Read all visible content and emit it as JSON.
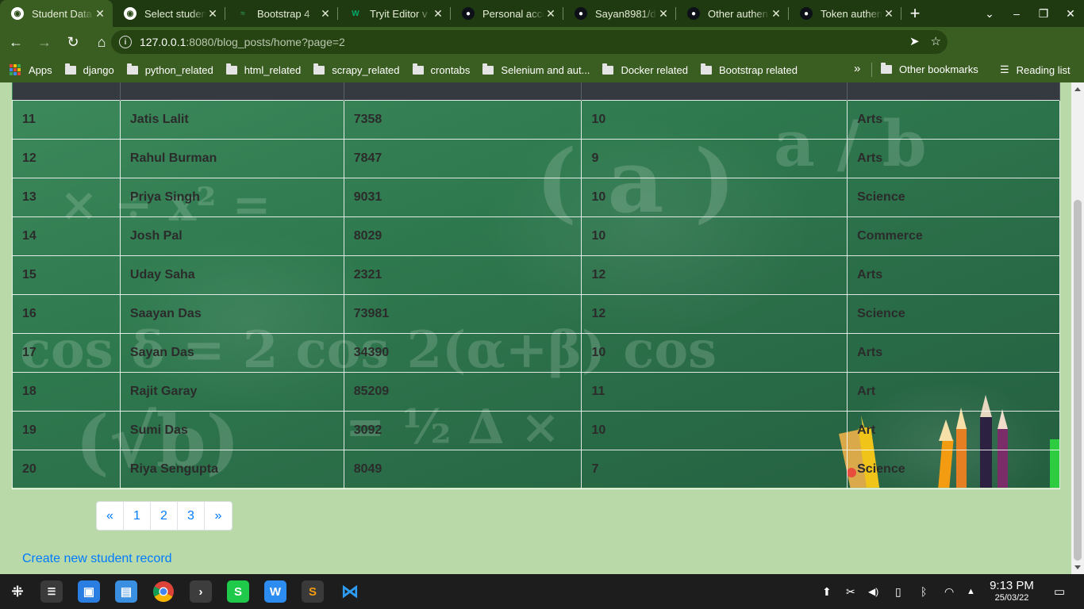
{
  "tabs": [
    {
      "title": "Student Data",
      "favicon": "globe-icon",
      "active": true
    },
    {
      "title": "Select studen",
      "favicon": "globe-icon",
      "active": false
    },
    {
      "title": "Bootstrap 4",
      "favicon": "geeks-icon",
      "active": false
    },
    {
      "title": "Tryit Editor v",
      "favicon": "w3schools-icon",
      "active": false
    },
    {
      "title": "Personal acco",
      "favicon": "github-icon",
      "active": false
    },
    {
      "title": "Sayan8981/d",
      "favicon": "github-icon",
      "active": false
    },
    {
      "title": "Other authen",
      "favicon": "github-icon",
      "active": false
    },
    {
      "title": "Token authen",
      "favicon": "github-icon",
      "active": false
    }
  ],
  "omnibox": {
    "host": "127.0.0.1",
    "path": ":8080/blog_posts/home?page=2"
  },
  "bookmarks": [
    {
      "label": "Apps",
      "icon": "apps-grid-icon"
    },
    {
      "label": "django",
      "icon": "folder-icon"
    },
    {
      "label": "python_related",
      "icon": "folder-icon"
    },
    {
      "label": "html_related",
      "icon": "folder-icon"
    },
    {
      "label": "scrapy_related",
      "icon": "folder-icon"
    },
    {
      "label": "crontabs",
      "icon": "folder-icon"
    },
    {
      "label": "Selenium and aut...",
      "icon": "folder-icon"
    },
    {
      "label": "Docker related",
      "icon": "folder-icon"
    },
    {
      "label": "Bootstrap related",
      "icon": "folder-icon"
    }
  ],
  "bookmarks_more": "»",
  "other_bookmarks": "Other bookmarks",
  "reading_list": "Reading list",
  "students": [
    [
      "11",
      "Jatis Lalit",
      "7358",
      "10",
      "Arts"
    ],
    [
      "12",
      "Rahul Burman",
      "7847",
      "9",
      "Arts"
    ],
    [
      "13",
      "Priya Singh",
      "9031",
      "10",
      "Science"
    ],
    [
      "14",
      "Josh Pal",
      "8029",
      "10",
      "Commerce"
    ],
    [
      "15",
      "Uday Saha",
      "2321",
      "12",
      "Arts"
    ],
    [
      "16",
      "Saayan Das",
      "73981",
      "12",
      "Science"
    ],
    [
      "17",
      "Sayan Das",
      "34390",
      "10",
      "Arts"
    ],
    [
      "18",
      "Rajit Garay",
      "85209",
      "11",
      "Art"
    ],
    [
      "19",
      "Sumi Das",
      "3092",
      "10",
      "Art"
    ],
    [
      "20",
      "Riya Sengupta",
      "8049",
      "7",
      "Science"
    ]
  ],
  "pagination": [
    "«",
    "1",
    "2",
    "3",
    "»"
  ],
  "create_link": "Create new student record",
  "clock": {
    "time": "9:13 PM",
    "date": "25/03/22"
  },
  "colors": {
    "tab_bar": "#1f3a10",
    "toolbar": "#3a5e21",
    "page_bg": "#b9d9a8",
    "link": "#007bff",
    "table_header": "#343a40"
  }
}
